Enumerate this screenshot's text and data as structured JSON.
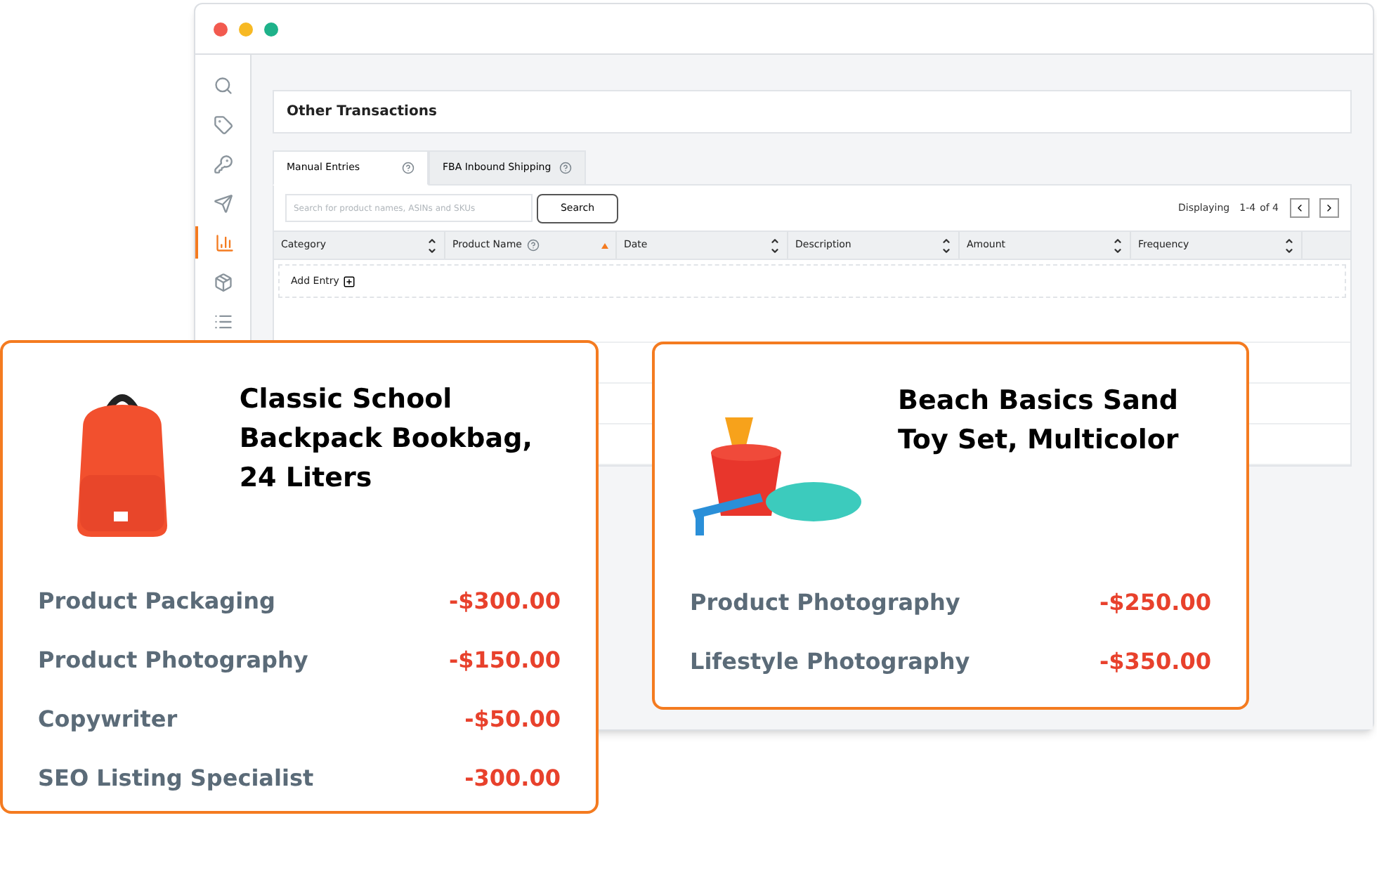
{
  "panel": {
    "title": "Other Transactions"
  },
  "tabs": [
    {
      "label": "Manual Entries",
      "selected": true
    },
    {
      "label": "FBA Inbound Shipping",
      "selected": false
    }
  ],
  "search": {
    "placeholder": "Search for product names, ASINs and SKUs",
    "button": "Search"
  },
  "pagination": {
    "label": "Displaying",
    "range": "1-4",
    "total": "of 4"
  },
  "table": {
    "columns": [
      {
        "label": "Category",
        "help": false,
        "sorted": false
      },
      {
        "label": "Product Name",
        "help": true,
        "sorted": true
      },
      {
        "label": "Date",
        "help": false,
        "sorted": false
      },
      {
        "label": "Description",
        "help": false,
        "sorted": false
      },
      {
        "label": "Amount",
        "help": false,
        "sorted": false
      },
      {
        "label": "Frequency",
        "help": false,
        "sorted": false
      }
    ],
    "add_entry": "Add Entry"
  },
  "sidebar": {
    "items": [
      {
        "kind": "search",
        "selected": false
      },
      {
        "kind": "tag",
        "selected": false
      },
      {
        "kind": "key",
        "selected": false
      },
      {
        "kind": "send",
        "selected": false
      },
      {
        "kind": "chart",
        "selected": true
      },
      {
        "kind": "box",
        "selected": false
      },
      {
        "kind": "list",
        "selected": false
      }
    ]
  },
  "cards": [
    {
      "kind": "backpack",
      "title": "Classic School Backpack Bookbag, 24 Liters",
      "lines": [
        {
          "label": "Product Packaging",
          "amount": "-$300.00"
        },
        {
          "label": "Product Photography",
          "amount": "-$150.00"
        },
        {
          "label": "Copywriter",
          "amount": "-$50.00"
        },
        {
          "label": "SEO Listing Specialist",
          "amount": "-300.00"
        }
      ]
    },
    {
      "kind": "beach-toys",
      "title": "Beach Basics Sand Toy Set, Multicolor",
      "lines": [
        {
          "label": "Product Photography",
          "amount": "-$250.00"
        },
        {
          "label": "Lifestyle Photography",
          "amount": "-$350.00"
        }
      ]
    }
  ]
}
